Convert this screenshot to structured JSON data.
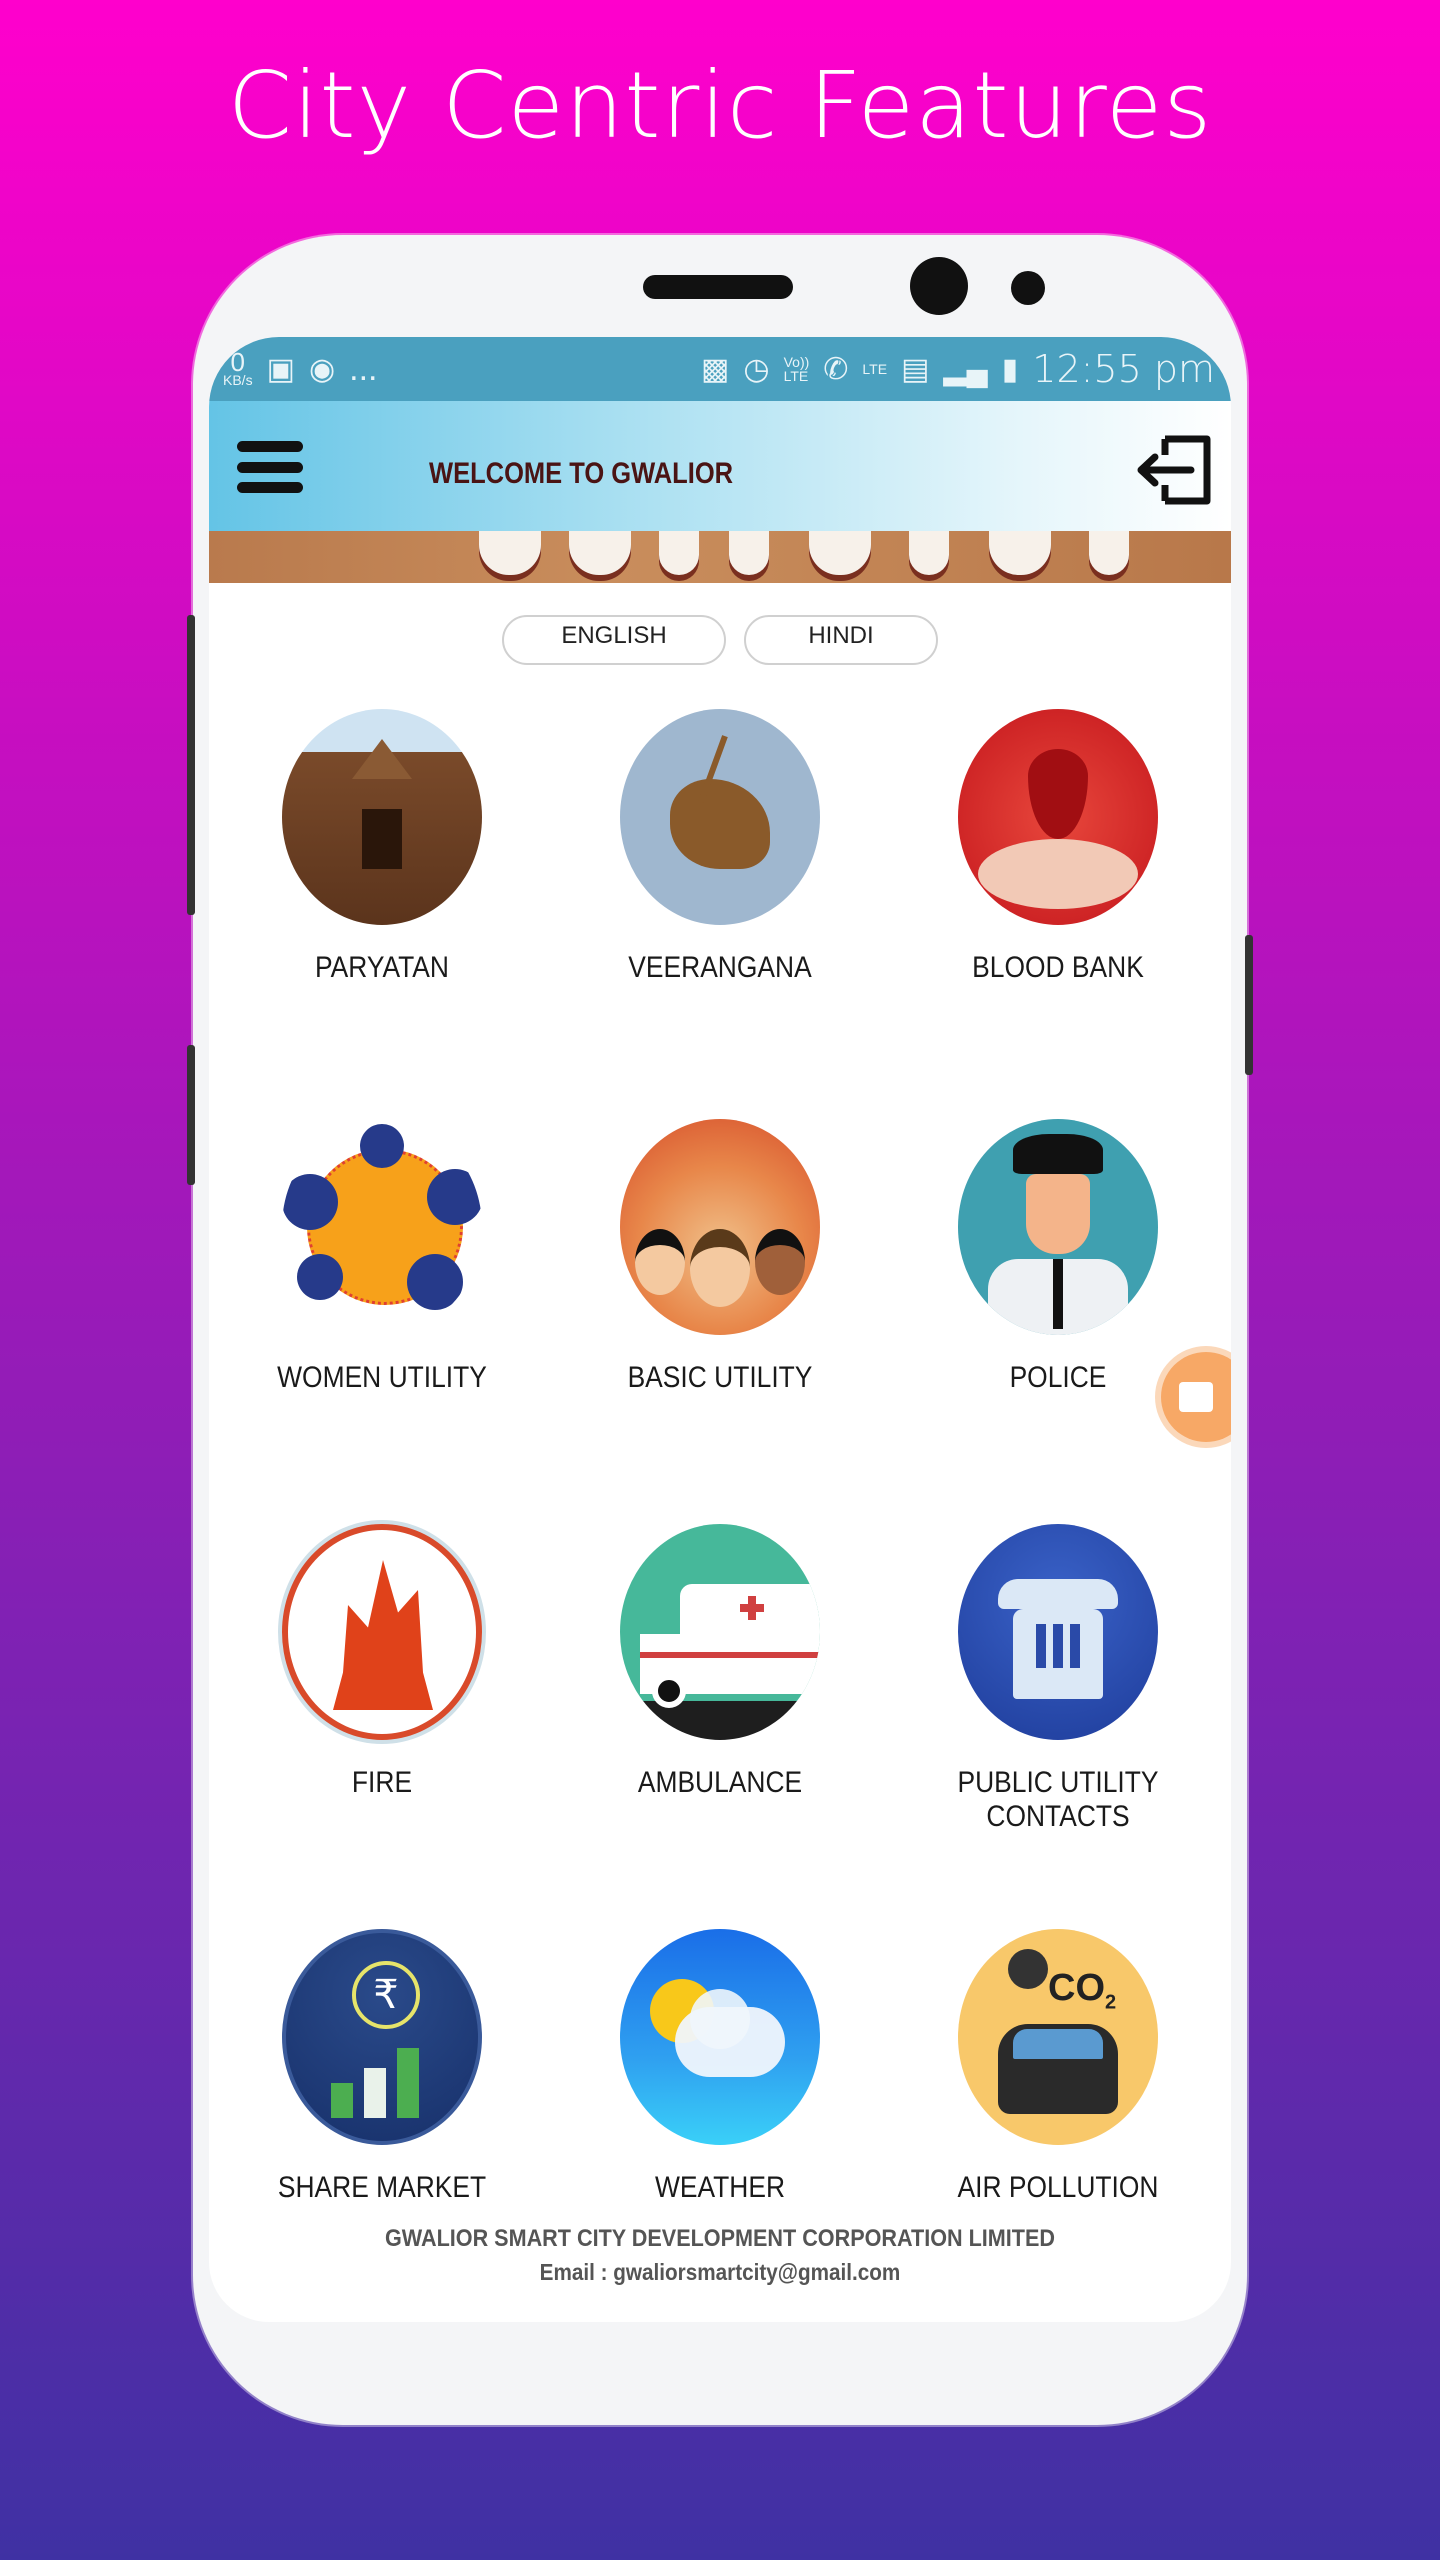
{
  "promo": {
    "title": "City Centric Features"
  },
  "statusbar": {
    "speed_value": "0",
    "speed_unit": "KB/s",
    "overflow": "...",
    "time": "12:55 pm",
    "left_icons": [
      "gallery-icon",
      "instagram-icon"
    ],
    "right_icons": [
      "cast-icon",
      "alarm-icon",
      "volte-icon",
      "call-icon",
      "lte-data-icon",
      "signal-roaming-icon",
      "signal-icon",
      "battery-icon"
    ]
  },
  "appbar": {
    "title": "WELCOME TO GWALIOR",
    "menu_icon": "hamburger-icon",
    "logout_icon": "logout-icon"
  },
  "language": {
    "english": "ENGLISH",
    "hindi": "HINDI"
  },
  "features": [
    {
      "label": "PARYATAN",
      "icon": "temple-icon"
    },
    {
      "label": "VEERANGANA",
      "icon": "statue-horse-icon"
    },
    {
      "label": "BLOOD BANK",
      "icon": "blood-drop-icon"
    },
    {
      "label": "WOMEN UTILITY",
      "icon": "women-utility-icon"
    },
    {
      "label": "BASIC UTILITY",
      "icon": "crowd-icon"
    },
    {
      "label": "POLICE",
      "icon": "police-officer-icon"
    },
    {
      "label": "FIRE",
      "icon": "fire-icon"
    },
    {
      "label": "AMBULANCE",
      "icon": "ambulance-icon"
    },
    {
      "label": "PUBLIC UTILITY CONTACTS",
      "icon": "telephone-icon"
    },
    {
      "label": "SHARE MARKET",
      "icon": "rupee-chart-icon"
    },
    {
      "label": "WEATHER",
      "icon": "sun-cloud-icon"
    },
    {
      "label": "AIR POLLUTION",
      "icon": "car-co2-icon"
    }
  ],
  "footer": {
    "org": "GWALIOR SMART CITY DEVELOPMENT CORPORATION LIMITED",
    "email": "Email : gwaliorsmartcity@gmail.com"
  },
  "fab": {
    "icon": "video-camera-icon"
  },
  "colors": {
    "statusbar": "#4aa0bf",
    "appbar_start": "#64c4e6",
    "title_text": "#4a1414",
    "fab": "#f7a866"
  }
}
